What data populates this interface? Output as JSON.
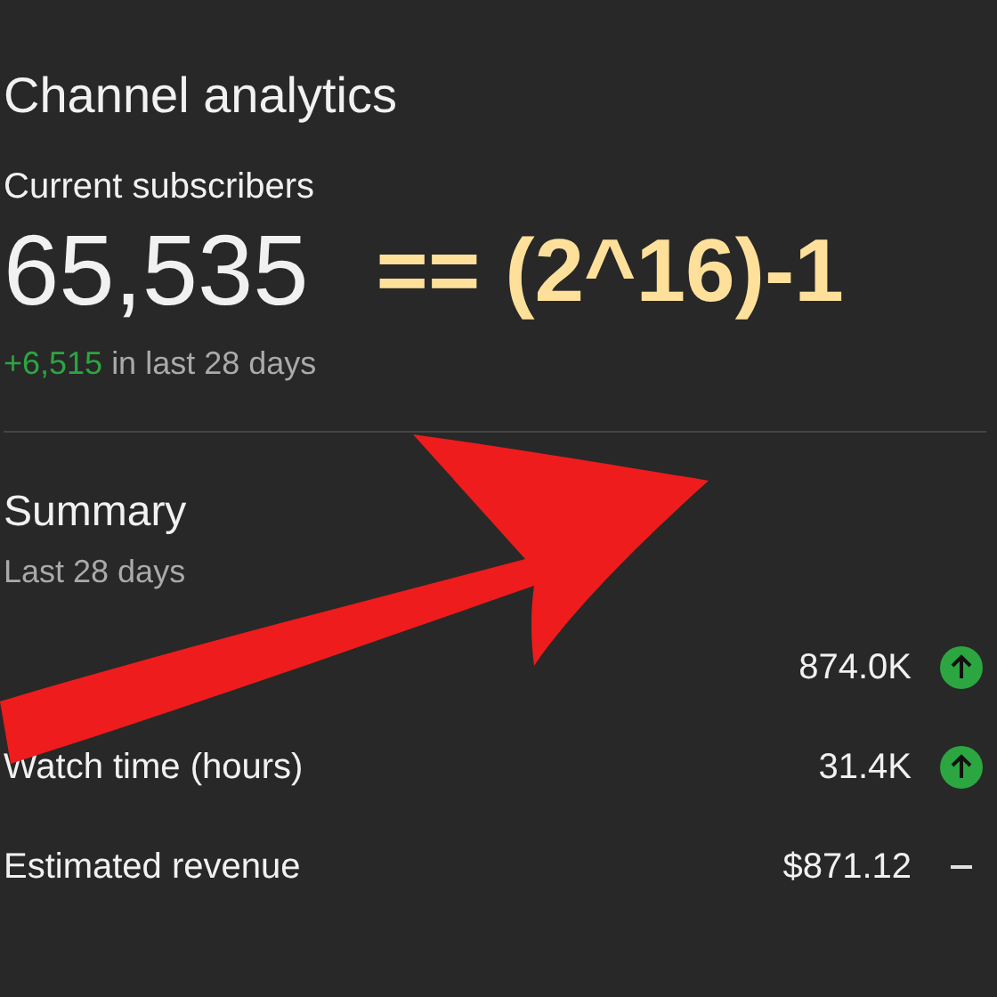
{
  "title": "Channel analytics",
  "subscribers": {
    "label": "Current subscribers",
    "count": "65,535",
    "change": "+6,515",
    "period": "in last 28 days"
  },
  "annotation": "== (2^16)-1",
  "summary": {
    "title": "Summary",
    "period": "Last 28 days",
    "rows": [
      {
        "value": "874.0K",
        "kind": "up"
      },
      {
        "label": "Watch time (hours)",
        "value": "31.4K",
        "kind": "up"
      },
      {
        "label": "Estimated revenue",
        "value": "$871.12",
        "kind": "flat"
      }
    ]
  }
}
